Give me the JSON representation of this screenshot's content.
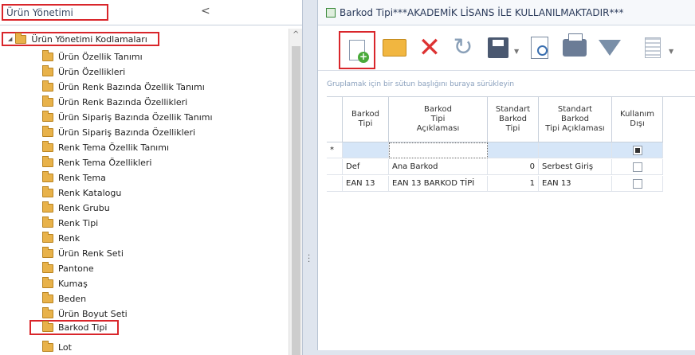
{
  "left_panel": {
    "title": "Ürün Yönetimi",
    "collapse_glyph": "<",
    "root_label": "Ürün Yönetimi Kodlamaları",
    "items": [
      "Ürün Özellik Tanımı",
      "Ürün Özellikleri",
      "Ürün Renk Bazında Özellik Tanımı",
      "Ürün Renk Bazında Özellikleri",
      "Ürün Sipariş Bazında Özellik Tanımı",
      "Ürün Sipariş Bazında Özellikleri",
      "Renk Tema Özellik Tanımı",
      "Renk Tema Özellikleri",
      "Renk Tema",
      "Renk Katalogu",
      "Renk Grubu",
      "Renk Tipi",
      "Renk",
      "Ürün Renk Seti",
      "Pantone",
      "Kumaş",
      "Beden",
      "Ürün Boyut Seti",
      "Barkod Tipi",
      "Lot"
    ]
  },
  "right_panel": {
    "title": "Barkod Tipi***AKADEMİK LİSANS İLE KULLANILMAKTADIR***",
    "group_hint": "Gruplamak için bir sütun başlığını buraya sürükleyin",
    "columns": [
      "Barkod\nTipi",
      "Barkod\nTipi\nAçıklaması",
      "Standart\nBarkod\nTipi",
      "Standart\nBarkod\nTipi Açıklaması",
      "Kullanım\nDışı"
    ],
    "new_row_indicator": "*",
    "rows": [
      {
        "code": "Def",
        "desc": "Ana Barkod",
        "std": "0",
        "std_desc": "Serbest Giriş",
        "disabled": false
      },
      {
        "code": "EAN 13",
        "desc": "EAN 13 BARKOD TİPİ",
        "std": "1",
        "std_desc": "EAN 13",
        "disabled": false
      }
    ]
  },
  "icons": {
    "new": "new-document-icon",
    "open": "folder-open-icon",
    "delete": "delete-x-icon",
    "refresh": "refresh-icon",
    "save": "save-icon",
    "preview": "print-preview-icon",
    "print": "printer-icon",
    "filter": "filter-icon",
    "columns": "columns-icon"
  },
  "colors": {
    "highlight_border": "#d9262b",
    "new_row_bg": "#d6e6f8",
    "folder": "#e8b24a"
  }
}
